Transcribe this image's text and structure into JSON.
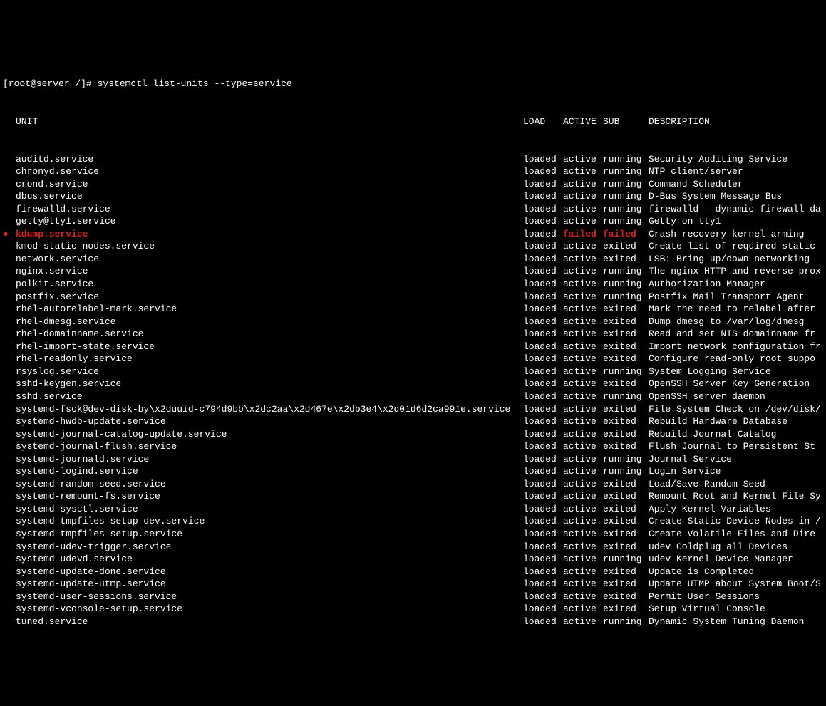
{
  "prompt": "[root@server /]# ",
  "command": "systemctl list-units --type=service",
  "headers": {
    "unit": "UNIT",
    "load": "LOAD",
    "active": "ACTIVE",
    "sub": "SUB",
    "description": "DESCRIPTION"
  },
  "services": [
    {
      "unit": "auditd.service",
      "load": "loaded",
      "active": "active",
      "sub": "running",
      "desc": "Security Auditing Service",
      "failed": false
    },
    {
      "unit": "chronyd.service",
      "load": "loaded",
      "active": "active",
      "sub": "running",
      "desc": "NTP client/server",
      "failed": false
    },
    {
      "unit": "crond.service",
      "load": "loaded",
      "active": "active",
      "sub": "running",
      "desc": "Command Scheduler",
      "failed": false
    },
    {
      "unit": "dbus.service",
      "load": "loaded",
      "active": "active",
      "sub": "running",
      "desc": "D-Bus System Message Bus",
      "failed": false
    },
    {
      "unit": "firewalld.service",
      "load": "loaded",
      "active": "active",
      "sub": "running",
      "desc": "firewalld - dynamic firewall da",
      "failed": false
    },
    {
      "unit": "getty@tty1.service",
      "load": "loaded",
      "active": "active",
      "sub": "running",
      "desc": "Getty on tty1",
      "failed": false
    },
    {
      "unit": "kdump.service",
      "load": "loaded",
      "active": "failed",
      "sub": "failed",
      "desc": "Crash recovery kernel arming",
      "failed": true
    },
    {
      "unit": "kmod-static-nodes.service",
      "load": "loaded",
      "active": "active",
      "sub": "exited",
      "desc": "Create list of required static",
      "failed": false
    },
    {
      "unit": "network.service",
      "load": "loaded",
      "active": "active",
      "sub": "exited",
      "desc": "LSB: Bring up/down networking",
      "failed": false
    },
    {
      "unit": "nginx.service",
      "load": "loaded",
      "active": "active",
      "sub": "running",
      "desc": "The nginx HTTP and reverse prox",
      "failed": false
    },
    {
      "unit": "polkit.service",
      "load": "loaded",
      "active": "active",
      "sub": "running",
      "desc": "Authorization Manager",
      "failed": false
    },
    {
      "unit": "postfix.service",
      "load": "loaded",
      "active": "active",
      "sub": "running",
      "desc": "Postfix Mail Transport Agent",
      "failed": false
    },
    {
      "unit": "rhel-autorelabel-mark.service",
      "load": "loaded",
      "active": "active",
      "sub": "exited",
      "desc": "Mark the need to relabel after",
      "failed": false
    },
    {
      "unit": "rhel-dmesg.service",
      "load": "loaded",
      "active": "active",
      "sub": "exited",
      "desc": "Dump dmesg to /var/log/dmesg",
      "failed": false
    },
    {
      "unit": "rhel-domainname.service",
      "load": "loaded",
      "active": "active",
      "sub": "exited",
      "desc": "Read and set NIS domainname fr",
      "failed": false
    },
    {
      "unit": "rhel-import-state.service",
      "load": "loaded",
      "active": "active",
      "sub": "exited",
      "desc": "Import network configuration fr",
      "failed": false
    },
    {
      "unit": "rhel-readonly.service",
      "load": "loaded",
      "active": "active",
      "sub": "exited",
      "desc": "Configure read-only root suppo",
      "failed": false
    },
    {
      "unit": "rsyslog.service",
      "load": "loaded",
      "active": "active",
      "sub": "running",
      "desc": "System Logging Service",
      "failed": false
    },
    {
      "unit": "sshd-keygen.service",
      "load": "loaded",
      "active": "active",
      "sub": "exited",
      "desc": "OpenSSH Server Key Generation",
      "failed": false
    },
    {
      "unit": "sshd.service",
      "load": "loaded",
      "active": "active",
      "sub": "running",
      "desc": "OpenSSH server daemon",
      "failed": false
    },
    {
      "unit": "systemd-fsck@dev-disk-by\\x2duuid-c794d9bb\\x2dc2aa\\x2d467e\\x2db3e4\\x2d01d6d2ca991e.service",
      "load": "loaded",
      "active": "active",
      "sub": "exited",
      "desc": "File System Check on /dev/disk/",
      "failed": false
    },
    {
      "unit": "systemd-hwdb-update.service",
      "load": "loaded",
      "active": "active",
      "sub": "exited",
      "desc": "Rebuild Hardware Database",
      "failed": false
    },
    {
      "unit": "systemd-journal-catalog-update.service",
      "load": "loaded",
      "active": "active",
      "sub": "exited",
      "desc": "Rebuild Journal Catalog",
      "failed": false
    },
    {
      "unit": "systemd-journal-flush.service",
      "load": "loaded",
      "active": "active",
      "sub": "exited",
      "desc": "Flush Journal to Persistent St",
      "failed": false
    },
    {
      "unit": "systemd-journald.service",
      "load": "loaded",
      "active": "active",
      "sub": "running",
      "desc": "Journal Service",
      "failed": false
    },
    {
      "unit": "systemd-logind.service",
      "load": "loaded",
      "active": "active",
      "sub": "running",
      "desc": "Login Service",
      "failed": false
    },
    {
      "unit": "systemd-random-seed.service",
      "load": "loaded",
      "active": "active",
      "sub": "exited",
      "desc": "Load/Save Random Seed",
      "failed": false
    },
    {
      "unit": "systemd-remount-fs.service",
      "load": "loaded",
      "active": "active",
      "sub": "exited",
      "desc": "Remount Root and Kernel File Sy",
      "failed": false
    },
    {
      "unit": "systemd-sysctl.service",
      "load": "loaded",
      "active": "active",
      "sub": "exited",
      "desc": "Apply Kernel Variables",
      "failed": false
    },
    {
      "unit": "systemd-tmpfiles-setup-dev.service",
      "load": "loaded",
      "active": "active",
      "sub": "exited",
      "desc": "Create Static Device Nodes in /",
      "failed": false
    },
    {
      "unit": "systemd-tmpfiles-setup.service",
      "load": "loaded",
      "active": "active",
      "sub": "exited",
      "desc": "Create Volatile Files and Dire",
      "failed": false
    },
    {
      "unit": "systemd-udev-trigger.service",
      "load": "loaded",
      "active": "active",
      "sub": "exited",
      "desc": "udev Coldplug all Devices",
      "failed": false
    },
    {
      "unit": "systemd-udevd.service",
      "load": "loaded",
      "active": "active",
      "sub": "running",
      "desc": "udev Kernel Device Manager",
      "failed": false
    },
    {
      "unit": "systemd-update-done.service",
      "load": "loaded",
      "active": "active",
      "sub": "exited",
      "desc": "Update is Completed",
      "failed": false
    },
    {
      "unit": "systemd-update-utmp.service",
      "load": "loaded",
      "active": "active",
      "sub": "exited",
      "desc": "Update UTMP about System Boot/S",
      "failed": false
    },
    {
      "unit": "systemd-user-sessions.service",
      "load": "loaded",
      "active": "active",
      "sub": "exited",
      "desc": "Permit User Sessions",
      "failed": false
    },
    {
      "unit": "systemd-vconsole-setup.service",
      "load": "loaded",
      "active": "active",
      "sub": "exited",
      "desc": "Setup Virtual Console",
      "failed": false
    },
    {
      "unit": "tuned.service",
      "load": "loaded",
      "active": "active",
      "sub": "running",
      "desc": "Dynamic System Tuning Daemon",
      "failed": false
    }
  ]
}
